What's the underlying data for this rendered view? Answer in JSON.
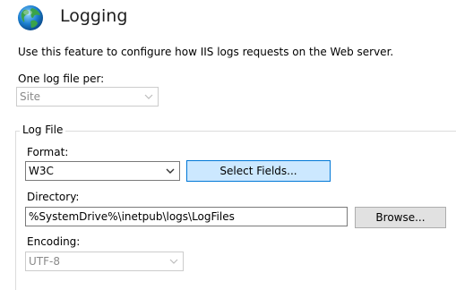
{
  "header": {
    "title": "Logging",
    "icon": "globe-icon"
  },
  "description": "Use this feature to configure how IIS logs requests on the Web server.",
  "log_per": {
    "label": "One log file per:",
    "value": "Site",
    "disabled": true
  },
  "log_file": {
    "group_title": "Log File",
    "format_label": "Format:",
    "format_value": "W3C",
    "select_fields_label": "Select Fields...",
    "directory_label": "Directory:",
    "directory_value": "%SystemDrive%\\inetpub\\logs\\LogFiles",
    "browse_label": "Browse...",
    "encoding_label": "Encoding:",
    "encoding_value": "UTF-8",
    "encoding_disabled": true
  },
  "colors": {
    "primary_button_bg": "#cce8ff",
    "primary_button_border": "#0078d7",
    "disabled_text": "#8a8a8a"
  }
}
